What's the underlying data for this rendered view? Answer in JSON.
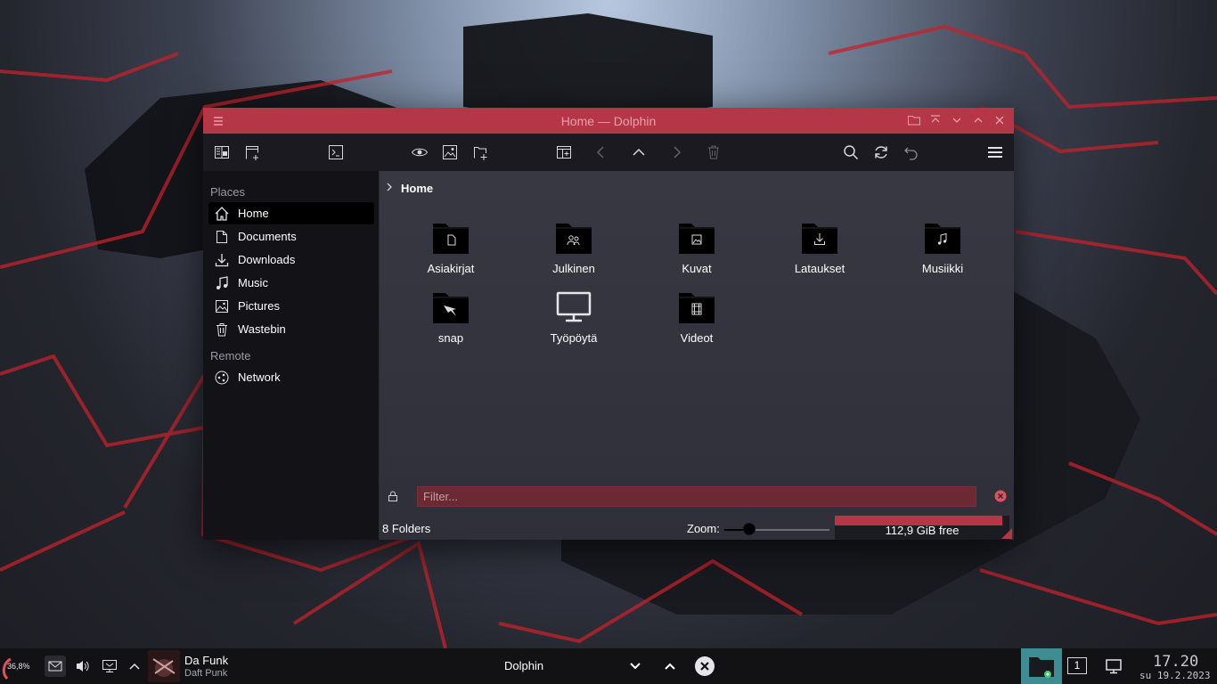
{
  "window": {
    "title": "Home — Dolphin"
  },
  "sidebar": {
    "places_label": "Places",
    "remote_label": "Remote",
    "places": [
      {
        "label": "Home",
        "icon": "home-icon",
        "active": true
      },
      {
        "label": "Documents",
        "icon": "documents-icon"
      },
      {
        "label": "Downloads",
        "icon": "downloads-icon"
      },
      {
        "label": "Music",
        "icon": "music-icon"
      },
      {
        "label": "Pictures",
        "icon": "pictures-icon"
      },
      {
        "label": "Wastebin",
        "icon": "wastebin-icon"
      }
    ],
    "remote": [
      {
        "label": "Network",
        "icon": "network-icon"
      }
    ]
  },
  "breadcrumb": {
    "current": "Home"
  },
  "folders": [
    {
      "name": "Asiakirjat",
      "icon": "folder-documents-icon"
    },
    {
      "name": "Julkinen",
      "icon": "folder-public-icon"
    },
    {
      "name": "Kuvat",
      "icon": "folder-pictures-icon"
    },
    {
      "name": "Lataukset",
      "icon": "folder-downloads-icon"
    },
    {
      "name": "Musiikki",
      "icon": "folder-music-icon"
    },
    {
      "name": "snap",
      "icon": "folder-snap-icon"
    },
    {
      "name": "Työpöytä",
      "icon": "desktop-icon"
    },
    {
      "name": "Videot",
      "icon": "folder-videos-icon"
    }
  ],
  "filter": {
    "placeholder": "Filter..."
  },
  "status": {
    "count": "8 Folders",
    "zoom_label": "Zoom:",
    "zoom_level": 0.24,
    "free_space": "112,9 GiB free",
    "used_fraction": 0.96
  },
  "taskbar": {
    "cpu": "36,8%",
    "media_title": "Da Funk",
    "media_artist": "Daft Punk",
    "task_title": "Dolphin",
    "pager": "1",
    "time": "17.20",
    "date": "su 19.2.2023"
  },
  "colors": {
    "accent": "#b53747",
    "window_bg": "#2a2a33",
    "sidebar_bg": "#121217",
    "taskbar_bg": "#121215"
  }
}
